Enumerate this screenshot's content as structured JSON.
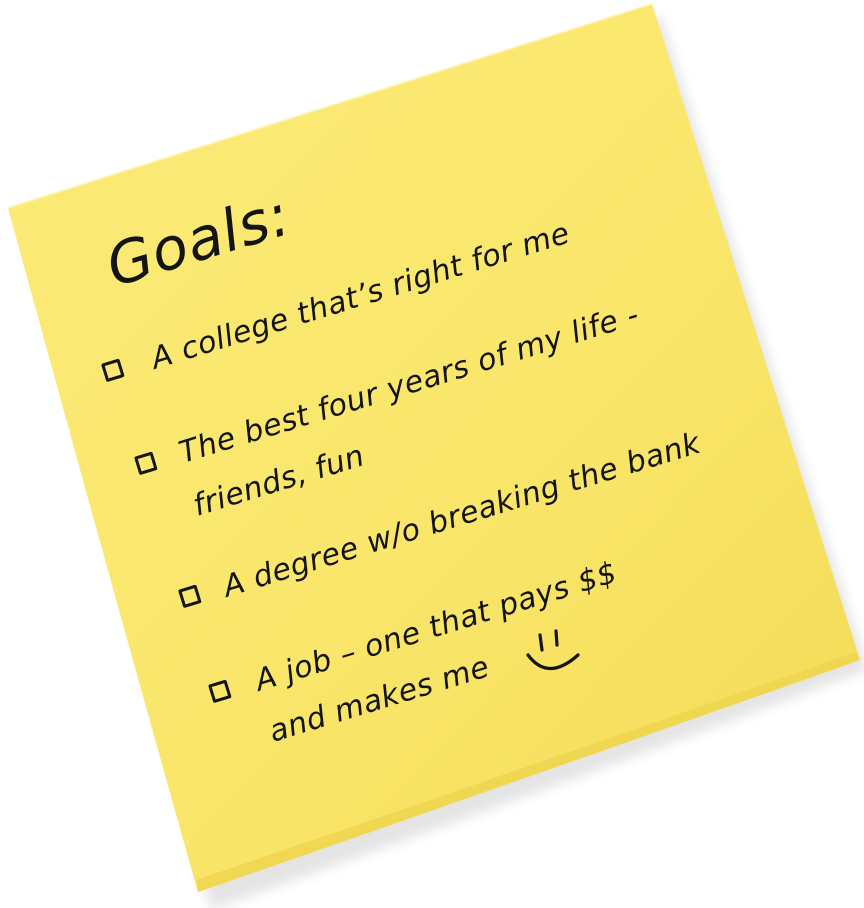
{
  "note": {
    "color": "#f9e66a",
    "shade_color": "#f0d54e",
    "ink_color": "#141414",
    "title": "Goals:",
    "items": [
      {
        "lines": [
          "A college that’s right for me"
        ],
        "checked": false
      },
      {
        "lines": [
          "The best four years of my life -",
          "friends, fun"
        ],
        "checked": false
      },
      {
        "lines": [
          "A degree w/o breaking the bank"
        ],
        "checked": false
      },
      {
        "lines": [
          "A job – one that pays $$",
          "and makes me"
        ],
        "checked": false,
        "doodle": "smiley-face"
      }
    ]
  }
}
